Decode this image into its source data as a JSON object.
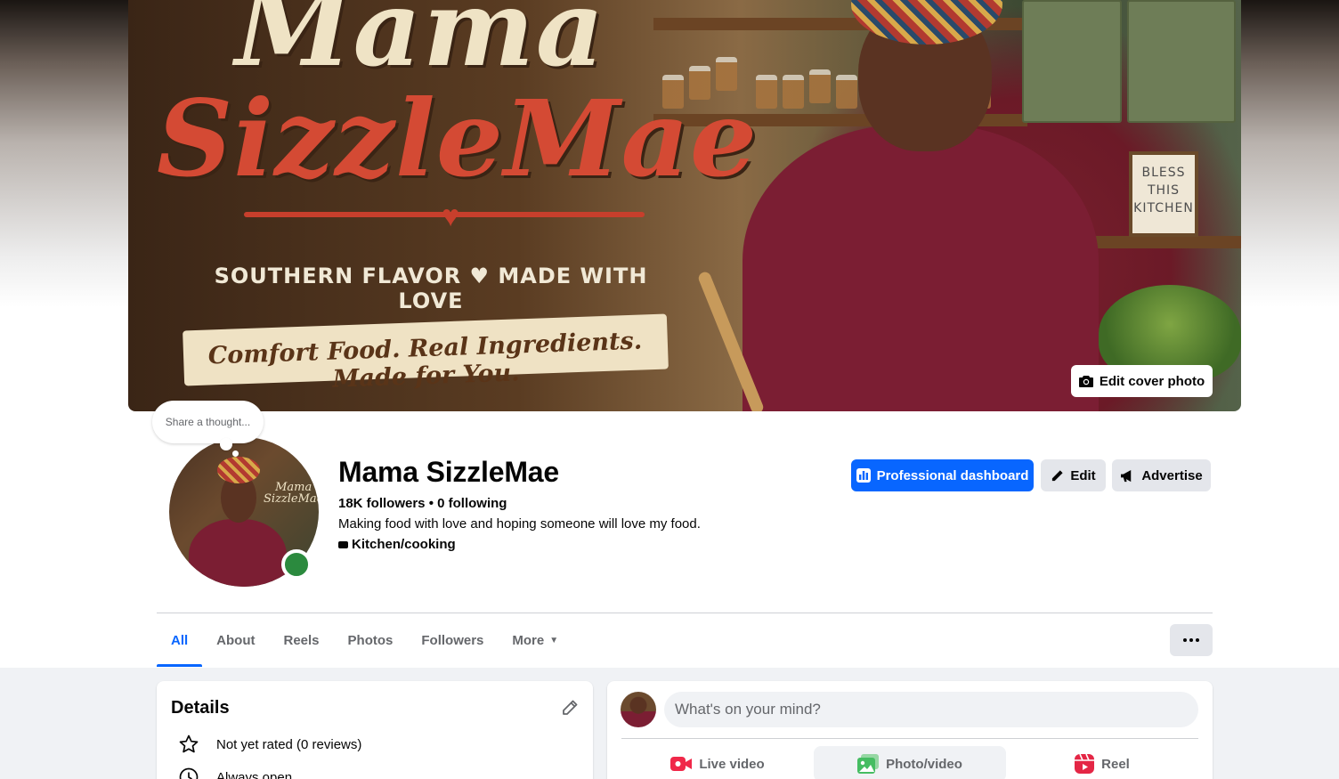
{
  "cover": {
    "title_line1": "Mama",
    "title_line2": "SizzleMae",
    "tagline": "SOUTHERN FLAVOR ♥ MADE WITH LOVE",
    "banner": "Comfort Food. Real Ingredients. Made for You.",
    "sign_text": [
      "BLESS",
      "THIS",
      "KITCHEN"
    ],
    "edit_button": "Edit cover photo",
    "edit_icon": "camera-icon"
  },
  "thought_bubble": "Share a thought...",
  "profile": {
    "name": "Mama SizzleMae",
    "stats": "18K followers • 0 following",
    "bio": "Making food with love and hoping someone will love my food.",
    "category": "Kitchen/cooking",
    "avatar_text": [
      "Mama",
      "SizzleMae"
    ],
    "online_status_color": "#2b8a3e"
  },
  "actions": {
    "professional_dashboard": "Professional dashboard",
    "edit": "Edit",
    "advertise": "Advertise"
  },
  "tabs": [
    {
      "label": "All",
      "active": true
    },
    {
      "label": "About",
      "active": false
    },
    {
      "label": "Reels",
      "active": false
    },
    {
      "label": "Photos",
      "active": false
    },
    {
      "label": "Followers",
      "active": false
    },
    {
      "label": "More",
      "active": false
    }
  ],
  "details": {
    "title": "Details",
    "rows": [
      {
        "icon": "star-icon",
        "text": "Not yet rated (0 reviews)"
      },
      {
        "icon": "clock-icon",
        "text": "Always open"
      }
    ]
  },
  "composer": {
    "placeholder": "What's on your mind?",
    "actions": [
      {
        "label": "Live video",
        "icon": "live-video-icon",
        "color": "#f02849"
      },
      {
        "label": "Photo/video",
        "icon": "photo-icon",
        "color": "#45bd62"
      },
      {
        "label": "Reel",
        "icon": "reel-icon",
        "color": "#e42645"
      }
    ]
  },
  "colors": {
    "accent": "#0866ff",
    "secondary_button": "#e4e6eb",
    "text_secondary": "#65676b"
  }
}
